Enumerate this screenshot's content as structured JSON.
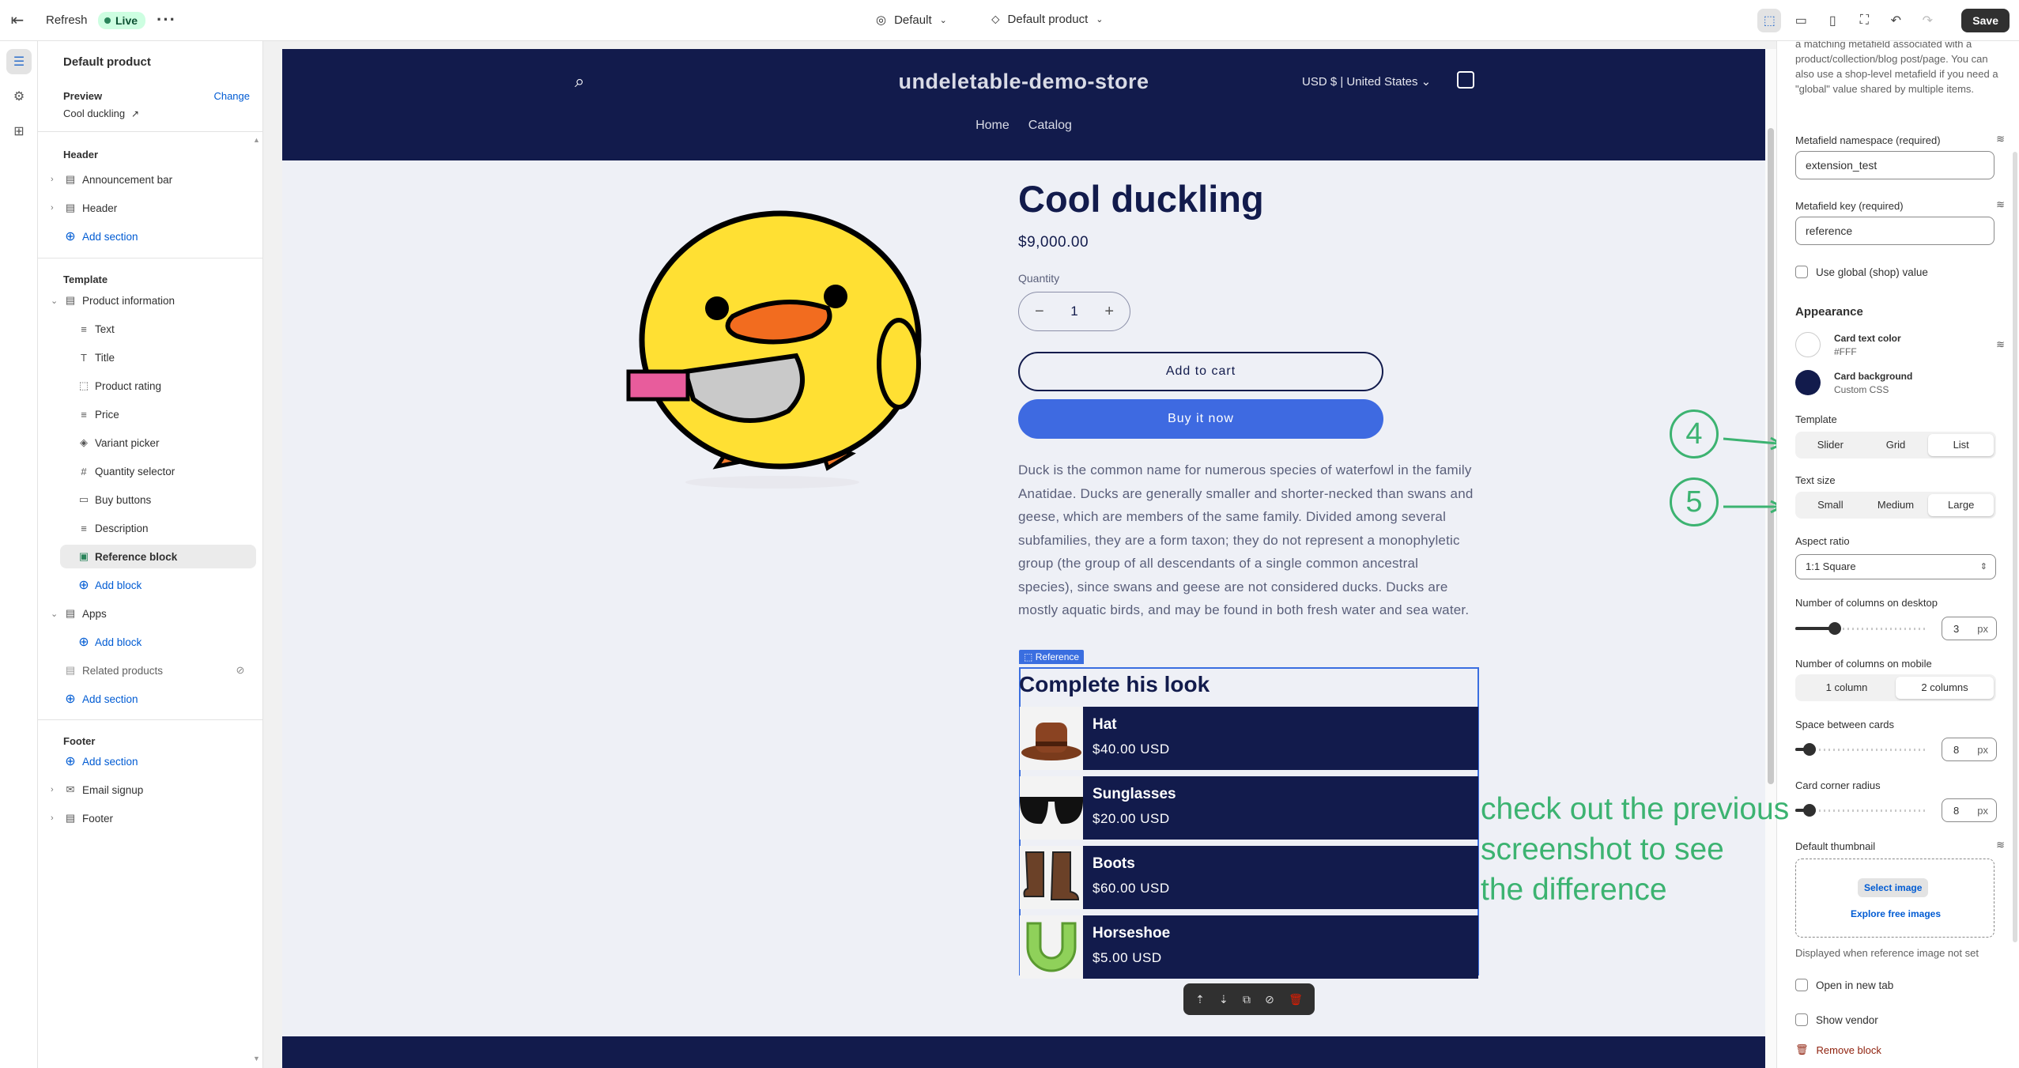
{
  "topbar": {
    "refresh": "Refresh",
    "live": "Live",
    "theme": "Default",
    "template": "Default product",
    "save": "Save"
  },
  "sidebar": {
    "title": "Default product",
    "preview_label": "Preview",
    "change": "Change",
    "preview_product": "Cool duckling",
    "header_group": "Header",
    "announcement_bar": "Announcement bar",
    "header": "Header",
    "add_section": "Add section",
    "template_group": "Template",
    "product_information": "Product information",
    "blocks": [
      "Text",
      "Title",
      "Product rating",
      "Price",
      "Variant picker",
      "Quantity selector",
      "Buy buttons",
      "Description",
      "Reference block"
    ],
    "add_block": "Add block",
    "apps": "Apps",
    "related_products": "Related products",
    "footer_group": "Footer",
    "email_signup": "Email signup",
    "footer": "Footer"
  },
  "store": {
    "name": "undeletable-demo-store",
    "currency": "USD $ | United States",
    "nav": [
      "Home",
      "Catalog"
    ],
    "product_title": "Cool duckling",
    "price": "$9,000.00",
    "quantity_label": "Quantity",
    "quantity": "1",
    "add_to_cart": "Add to cart",
    "buy_now": "Buy it now",
    "description": "Duck is the common name for numerous species of waterfowl in the family Anatidae. Ducks are generally smaller and shorter-necked than swans and geese, which are members of the same family. Divided among several subfamilies, they are a form taxon; they do not represent a monophyletic group (the group of all descendants of a single common ancestral species), since swans and geese are not considered ducks. Ducks are mostly aquatic birds, and may be found in both fresh water and sea water."
  },
  "reference": {
    "tag": "Reference",
    "title": "Complete his look",
    "items": [
      {
        "name": "Hat",
        "price": "$40.00 USD"
      },
      {
        "name": "Sunglasses",
        "price": "$20.00 USD"
      },
      {
        "name": "Boots",
        "price": "$60.00 USD"
      },
      {
        "name": "Horseshoe",
        "price": "$5.00 USD"
      }
    ]
  },
  "annotation": {
    "note": "check out the previous\nscreenshot to see\nthe difference",
    "callout_template": "4",
    "callout_text_size": "5",
    "color": "#3cb371"
  },
  "settings": {
    "help_text": "a matching metafield associated with a product/collection/blog post/page. You can also use a shop-level metafield if you need a \"global\" value shared by multiple items.",
    "namespace_label": "Metafield namespace (required)",
    "namespace_value": "extension_test",
    "key_label": "Metafield key (required)",
    "key_value": "reference",
    "use_global": "Use global (shop) value",
    "appearance": "Appearance",
    "card_text_color": "Card text color",
    "card_text_color_value": "#FFF",
    "card_background": "Card background",
    "card_background_value": "Custom CSS",
    "template_label": "Template",
    "template_options": [
      "Slider",
      "Grid",
      "List"
    ],
    "template_selected": "List",
    "text_size_label": "Text size",
    "text_size_options": [
      "Small",
      "Medium",
      "Large"
    ],
    "text_size_selected": "Large",
    "aspect_ratio_label": "Aspect ratio",
    "aspect_ratio_value": "1:1 Square",
    "cols_desktop_label": "Number of columns on desktop",
    "cols_desktop_value": "3",
    "cols_mobile_label": "Number of columns on mobile",
    "cols_mobile_options": [
      "1 column",
      "2 columns"
    ],
    "cols_mobile_selected": "2 columns",
    "space_label": "Space between cards",
    "space_value": "8",
    "radius_label": "Card corner radius",
    "radius_value": "8",
    "unit": "px",
    "thumb_label": "Default thumbnail",
    "select_image": "Select image",
    "explore_images": "Explore free images",
    "thumb_help": "Displayed when reference image not set",
    "open_new_tab": "Open in new tab",
    "show_vendor": "Show vendor",
    "remove_block": "Remove block"
  },
  "colors": {
    "store_navy": "#121b4c",
    "accent_blue": "#3e6ae1",
    "selection_blue": "#3a6ee0",
    "annotation_green": "#3cb371"
  }
}
